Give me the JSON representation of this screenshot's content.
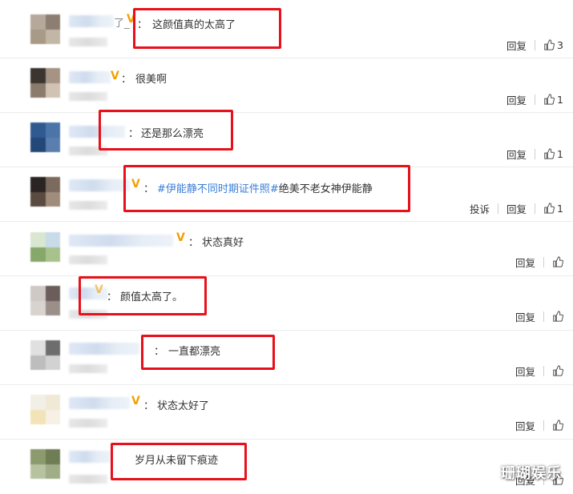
{
  "comments": [
    {
      "nick_suffix": "了_",
      "has_badge": true,
      "text": "这颜值真的太高了",
      "actions": {
        "report": "",
        "reply": "回复",
        "likes": "3"
      }
    },
    {
      "nick_suffix": "",
      "has_badge": true,
      "text": "很美啊",
      "actions": {
        "report": "",
        "reply": "回复",
        "likes": "1"
      }
    },
    {
      "nick_suffix": "",
      "has_badge": false,
      "text": "还是那么漂亮",
      "actions": {
        "report": "",
        "reply": "回复",
        "likes": "1"
      }
    },
    {
      "nick_suffix": "",
      "has_badge": true,
      "tag": "#伊能静不同时期证件照#",
      "text": "绝美不老女神伊能静",
      "actions": {
        "report": "投诉",
        "reply": "回复",
        "likes": "1"
      }
    },
    {
      "nick_suffix": "",
      "has_badge": true,
      "text": "状态真好",
      "actions": {
        "report": "",
        "reply": "回复",
        "likes": ""
      }
    },
    {
      "nick_suffix": "",
      "has_badge": true,
      "text": "颜值太高了。",
      "actions": {
        "report": "",
        "reply": "回复",
        "likes": ""
      }
    },
    {
      "nick_suffix": "",
      "has_badge": false,
      "text": "一直都漂亮",
      "actions": {
        "report": "",
        "reply": "回复",
        "likes": ""
      }
    },
    {
      "nick_suffix": "",
      "has_badge": true,
      "text": "状态太好了",
      "actions": {
        "report": "",
        "reply": "回复",
        "likes": ""
      }
    },
    {
      "nick_suffix": "",
      "has_badge": false,
      "text": "岁月从未留下痕迹",
      "actions": {
        "report": "",
        "reply": "回复",
        "likes": ""
      }
    }
  ],
  "badge_glyph": "V",
  "colon_glyph": "：",
  "watermark": "珊瑚娱乐",
  "colors": {
    "highlight_box": "#e8101a",
    "topic_link": "#3a7ed8",
    "badge": "#f2a100"
  }
}
